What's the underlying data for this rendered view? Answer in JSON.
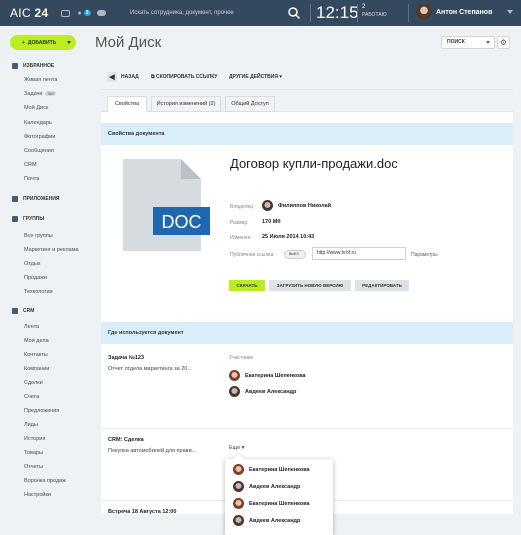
{
  "header": {
    "logo_main": "AIC",
    "logo_num": "24",
    "notif_count": "3",
    "search_placeholder": "Искать сотрудника, документ, прочее",
    "time": "12:15",
    "tasks_count": "2",
    "tasks_label": "РАБОТАЮ",
    "user_name": "Антон Степанов"
  },
  "sidebar": {
    "add_button": "ДОБАВИТЬ",
    "sections": [
      {
        "title": "ИЗБРАННОЕ",
        "items": [
          "Живая лента",
          "Задачи",
          "Мой Диск",
          "Календарь",
          "Фотографии",
          "Сообщения",
          "CRM",
          "Почта"
        ]
      },
      {
        "title": "ПРИЛОЖЕНИЯ",
        "items": []
      },
      {
        "title": "ГРУППЫ",
        "items": [
          "Все группы",
          "Маркетинг и реклама",
          "Отдых",
          "Продажи",
          "Техкологии"
        ]
      },
      {
        "title": "CRM",
        "items": [
          "Лента",
          "Мои дела",
          "Контакты",
          "Компании",
          "Сделки",
          "Счета",
          "Предложения",
          "Лиды",
          "История",
          "Товары",
          "Отчеты",
          "Воронка продаж",
          "Настройки"
        ]
      }
    ],
    "tasks_badge": "30+"
  },
  "main": {
    "title": "Мой Диск",
    "filter_label": "ПОИСК",
    "toolbar": {
      "back": "НАЗАД",
      "copy": "СКОПИРОВАТЬ ССЫЛКУ",
      "other": "ДРУГИЕ ДЕЙСТВИЯ"
    },
    "tabs": [
      "Свойства",
      "История изменений (2)",
      "Общий Доступ"
    ],
    "props_header": "Свойства документа",
    "doc_badge": "DOC",
    "doc_name": "Договор купли-продажи.doc",
    "owner_label": "Владелец:",
    "owner": "Филиппов Николай",
    "size_label": "Размер:",
    "size": "170 Mб",
    "changed_label": "Изменен:",
    "changed": "25 Июля 2014 10:43",
    "public_label": "Публичная ссылка:",
    "toggle": "ВЫКЛ",
    "url": "http://www.hrof.ru",
    "params": "Параметры",
    "buttons": {
      "download": "СКАЧАТЬ",
      "upload": "ЗАГРУЗИТЬ НОВУЮ ВЕРСИЮ",
      "edit": "РЕДАКТИРОВАТЬ"
    },
    "used_header": "Где используется документ",
    "usage": [
      {
        "title": "Задача №123",
        "sub": "Отчет отдела маркетинга за 20..."
      },
      {
        "title": "CRM: Сделка",
        "sub": "Покупка автомобилей для прави..."
      },
      {
        "title": "Встреча 18 Августа 12:00",
        "sub": ""
      }
    ],
    "participants_label": "Участники",
    "participants": [
      "Екатерина Шепенкова",
      "Авдеев Александр"
    ],
    "more": "Еще",
    "popup_people": [
      "Екатерина Шепенкова",
      "Авдеев Александр",
      "Екатерина Шепенкова",
      "Авдеев Александр"
    ]
  }
}
